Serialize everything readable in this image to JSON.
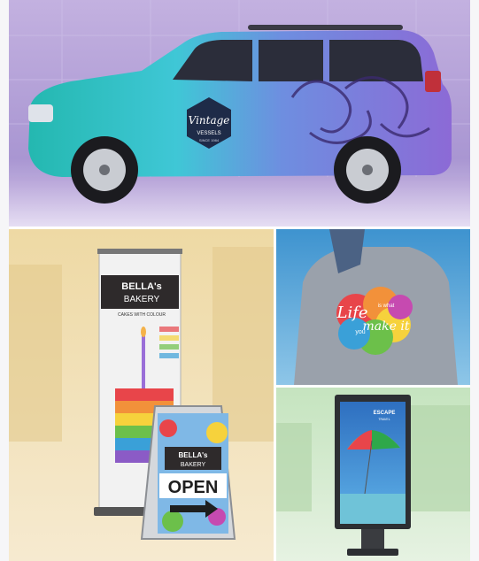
{
  "car_wrap": {
    "logo_line1": "Vintage",
    "logo_line2": "VESSELS",
    "logo_line3": "SINCE 1984"
  },
  "banner": {
    "brand_line1": "BELLA's",
    "brand_line2": "BAKERY",
    "tagline": "CAKES WITH COLOUR"
  },
  "aframe": {
    "brand_line1": "BELLA's",
    "brand_line2": "BAKERY",
    "open_text": "OPEN"
  },
  "tshirt": {
    "line1": "Life",
    "line2": "is what",
    "line3": "you",
    "line4": "make it"
  },
  "lightbox": {
    "brand": "ESCAPE",
    "sub": "TRAVEL"
  },
  "colors": {
    "car_bg": "#b9a6d8",
    "bakery_bg": "#f1deb0",
    "shirt_bg": "#5aa7d6",
    "sign_bg": "#cfe8c9"
  }
}
